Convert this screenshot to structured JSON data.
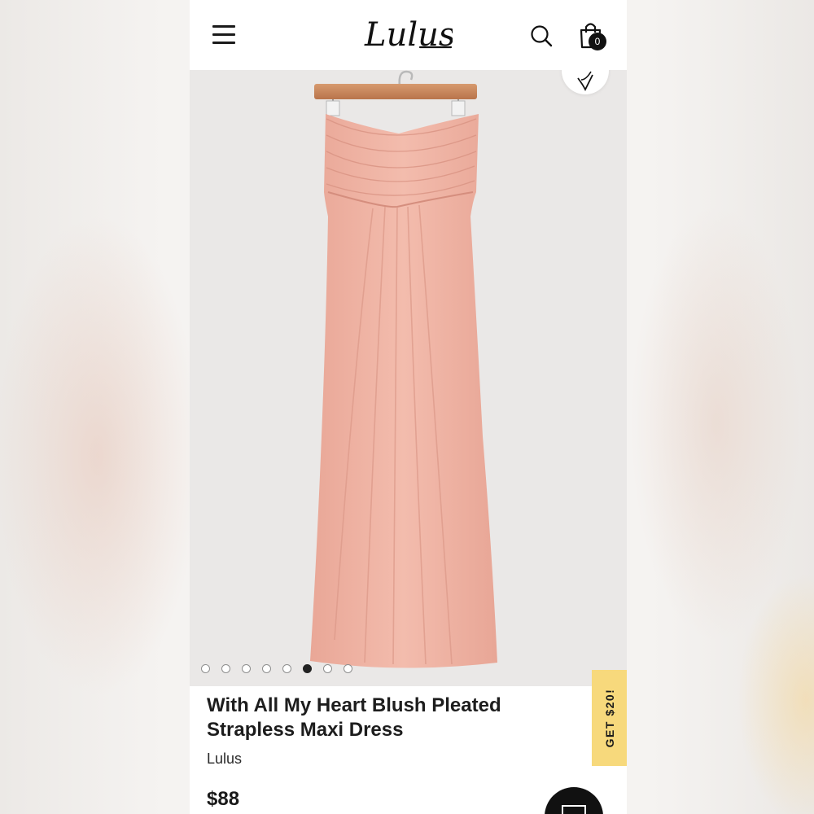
{
  "header": {
    "logo_text": "Lulus",
    "menu_icon": "hamburger-menu-icon",
    "search_icon": "search-icon",
    "bag_icon": "shopping-bag-icon",
    "bag_count": "0"
  },
  "gallery": {
    "image_count": 8,
    "active_index": 5,
    "wishlist_icon": "heart-v-icon"
  },
  "product": {
    "title": "With All My Heart Blush Pleated Strapless Maxi Dress",
    "brand": "Lulus",
    "price": "$88"
  },
  "promo": {
    "label": "GET $20!",
    "color": "#f7d97c"
  },
  "chat": {
    "icon": "chat-icon"
  },
  "colors": {
    "dress": "#efb5a6",
    "image_background": "#eae8e7",
    "hanger": "#c9865a"
  }
}
